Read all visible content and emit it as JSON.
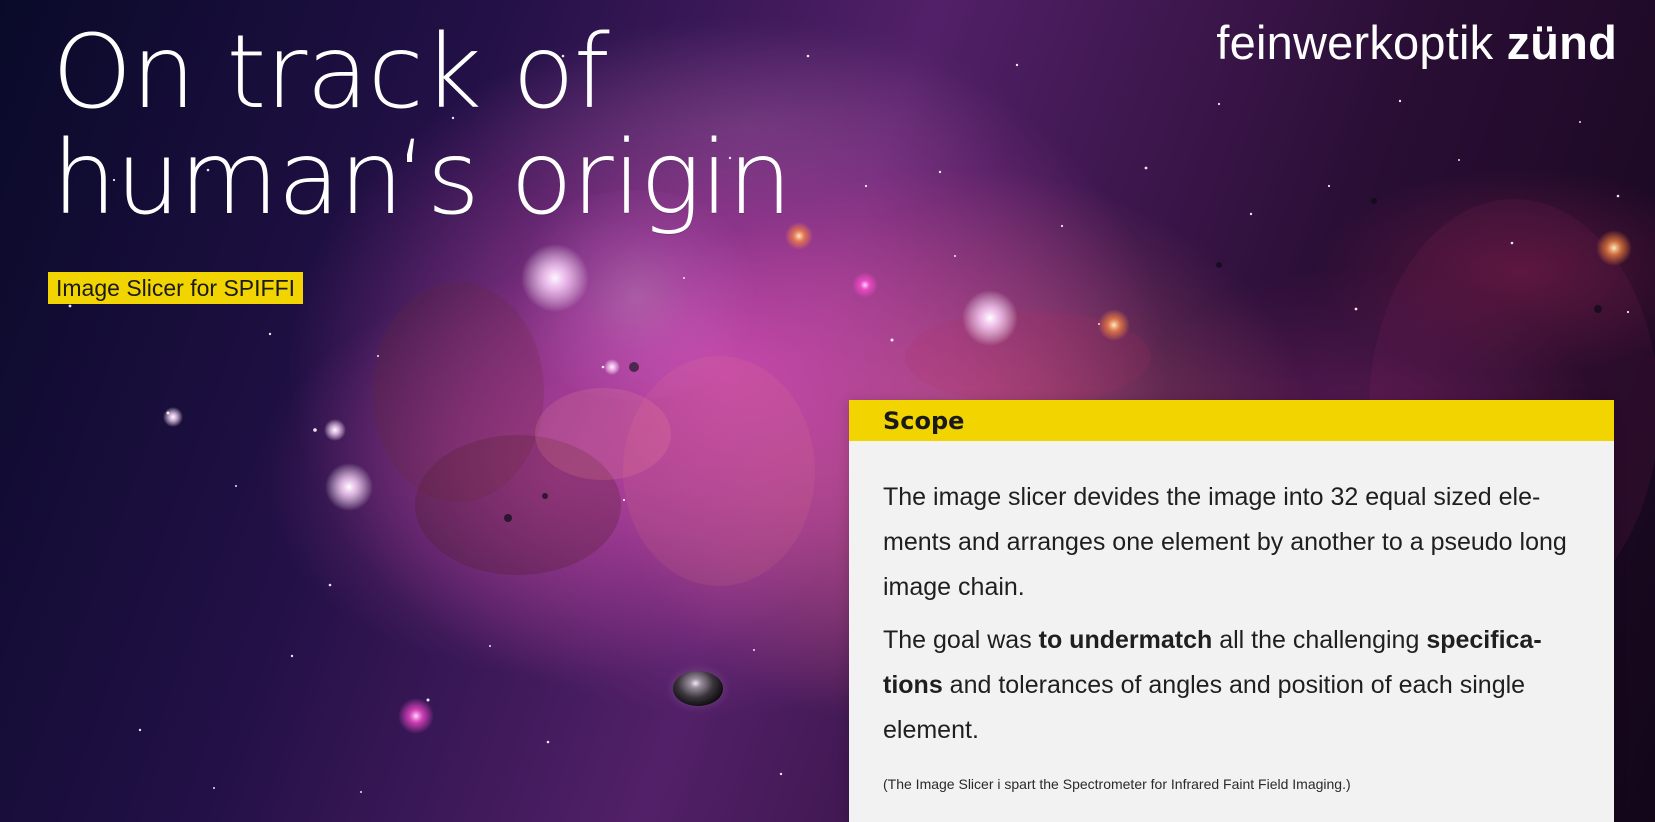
{
  "page": {
    "headline_line_1": "On track of",
    "headline_line_2": "human‘s origin",
    "subtitle": "Image Slicer for SPIFFI"
  },
  "brand": {
    "light": "feinwerkoptik",
    "bold": "zünd"
  },
  "scope": {
    "title": "Scope",
    "paragraph_1": "The image slicer devides the image into 32 equal sized ele-ments and arranges one element by another to a pseudo long image chain.",
    "paragraph_2_prefix": "The goal was ",
    "paragraph_2_emphasis_1": "to undermatch",
    "paragraph_2_middle": " all the challenging ",
    "paragraph_2_emphasis_2": "specifica-tions",
    "paragraph_2_suffix": " and tolerances of angles and position of each single element.",
    "footnote": "(The Image Slicer i spart the Spectrometer for Infrared Faint Field Imaging.)"
  },
  "colors": {
    "accent_yellow": "#f2d400",
    "card_background": "#f2f2f2",
    "headline_text": "#ffffff",
    "body_text": "#1f1f1f"
  },
  "icons": {
    "background_image": "galaxy-nebula-icon",
    "planet_image": "planet-icon"
  }
}
